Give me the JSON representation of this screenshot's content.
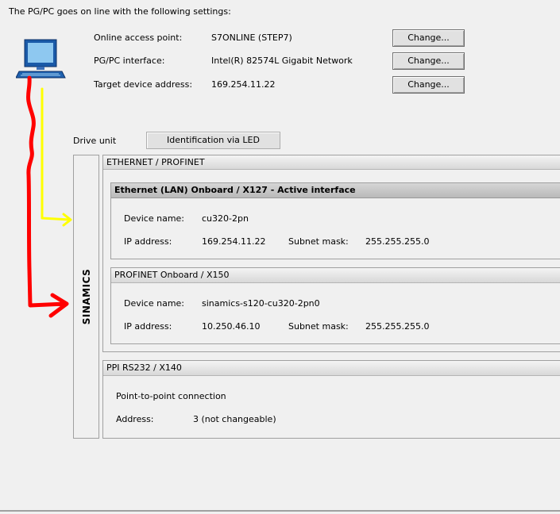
{
  "header": {
    "intro": "The PG/PC goes on line with the following settings:"
  },
  "settings": [
    {
      "label": "Online access point:",
      "value": "S7ONLINE (STEP7)",
      "button": "Change..."
    },
    {
      "label": "PG/PC interface:",
      "value": "Intel(R) 82574L Gigabit Network",
      "button": "Change..."
    },
    {
      "label": "Target device address:",
      "value": "169.254.11.22",
      "button": "Change..."
    }
  ],
  "drive_unit": {
    "label": "Drive unit",
    "identify_button": "Identification via LED",
    "device_label": "SINAMICS"
  },
  "ethernet_profinet": {
    "title": "ETHERNET / PROFINET",
    "lan": {
      "title": "Ethernet (LAN) Onboard / X127 - Active interface",
      "device_name_label": "Device name:",
      "device_name": "cu320-2pn",
      "ip_label": "IP address:",
      "ip": "169.254.11.22",
      "subnet_label": "Subnet mask:",
      "subnet": "255.255.255.0"
    },
    "profinet": {
      "title": "PROFINET Onboard / X150",
      "device_name_label": "Device name:",
      "device_name": "sinamics-s120-cu320-2pn0",
      "ip_label": "IP address:",
      "ip": "10.250.46.10",
      "subnet_label": "Subnet mask:",
      "subnet": "255.255.255.0"
    }
  },
  "ppi": {
    "title": "PPI RS232 / X140",
    "connection": "Point-to-point connection",
    "address_label": "Address:",
    "address": "3 (not changeable)"
  },
  "annotations": {
    "yellow_arrow_color": "#ffff00",
    "red_arrow_color": "#ff0000"
  },
  "icons": {
    "computer": "computer-icon"
  }
}
